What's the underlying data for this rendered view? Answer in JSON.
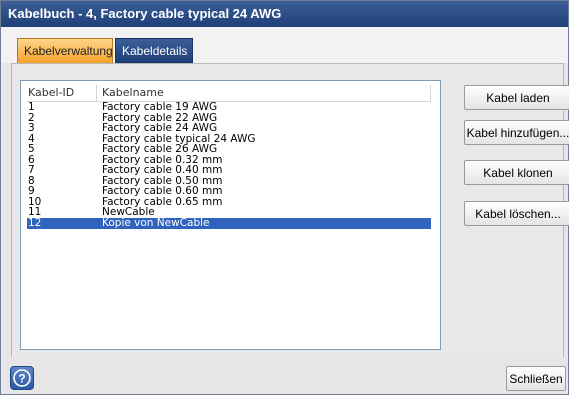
{
  "window": {
    "title": "Kabelbuch - 4, Factory cable typical 24 AWG"
  },
  "tabs": [
    {
      "label": "Kabelverwaltung",
      "active": true
    },
    {
      "label": "Kabeldetails",
      "active": false
    }
  ],
  "table": {
    "columns": [
      "Kabel-ID",
      "Kabelname"
    ],
    "rows": [
      {
        "id": "1",
        "name": "Factory cable 19 AWG"
      },
      {
        "id": "2",
        "name": "Factory cable 22 AWG"
      },
      {
        "id": "3",
        "name": "Factory cable 24 AWG"
      },
      {
        "id": "4",
        "name": "Factory cable typical 24 AWG"
      },
      {
        "id": "5",
        "name": "Factory cable 26 AWG"
      },
      {
        "id": "6",
        "name": "Factory cable 0.32 mm"
      },
      {
        "id": "7",
        "name": "Factory cable 0.40 mm"
      },
      {
        "id": "8",
        "name": "Factory cable 0.50 mm"
      },
      {
        "id": "9",
        "name": "Factory cable 0.60 mm"
      },
      {
        "id": "10",
        "name": "Factory cable 0.65 mm"
      },
      {
        "id": "11",
        "name": "NewCable"
      },
      {
        "id": "12",
        "name": "Kopie von NewCable",
        "selected": true
      }
    ]
  },
  "buttons": {
    "load": "Kabel laden",
    "add": "Kabel hinzufügen...",
    "clone": "Kabel klonen",
    "delete": "Kabel löschen..."
  },
  "footer": {
    "close": "Schließen",
    "help_icon": "question-mark-icon"
  },
  "colors": {
    "titlebar": "#1f3f78",
    "active_tab": "#f4a42a",
    "selection": "#2f63bd"
  }
}
